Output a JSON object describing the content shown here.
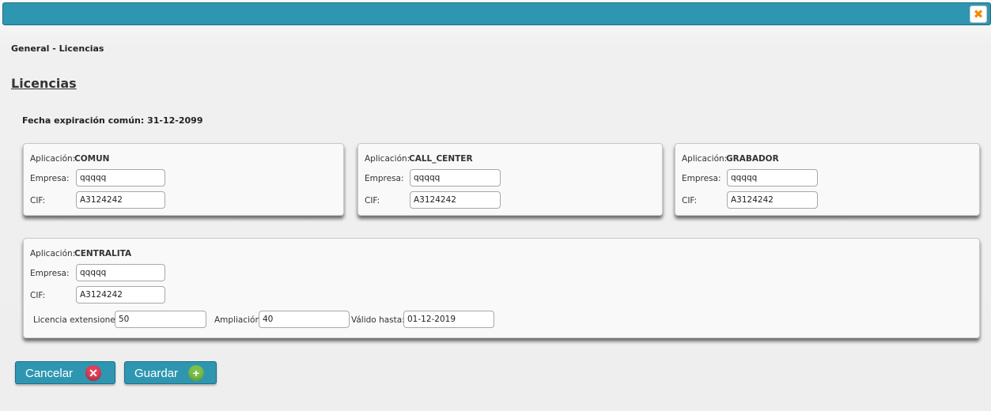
{
  "header": {
    "close_icon": "close-icon",
    "close_glyph": "✖"
  },
  "breadcrumb": "General - Licencias",
  "page_title": "Licencias",
  "common_expiration": "Fecha expiración común: 31-12-2099",
  "labels": {
    "aplicacion": "Aplicación:",
    "empresa": "Empresa:",
    "cif": "CIF:",
    "licencia_ext": "Licencia extensiones",
    "ampliacion": "Ampliación:",
    "valido_hasta": "Válido hasta:"
  },
  "panels": [
    {
      "app": "COMUN",
      "empresa": "qqqqq",
      "cif": "A3124242"
    },
    {
      "app": "CALL_CENTER",
      "empresa": "qqqqq",
      "cif": "A3124242"
    },
    {
      "app": "GRABADOR",
      "empresa": "qqqqq",
      "cif": "A3124242"
    },
    {
      "app": "CENTRALITA",
      "empresa": "qqqqq",
      "cif": "A3124242",
      "licencia_extensiones": "50",
      "ampliacion": "40",
      "valido_hasta": "01-12-2019"
    }
  ],
  "buttons": {
    "cancel_label": "Cancelar",
    "cancel_icon": "cancel-icon",
    "cancel_glyph": "✕",
    "save_label": "Guardar",
    "save_icon": "add-icon",
    "save_glyph": "+"
  },
  "colors": {
    "accent": "#2e96b0",
    "close": "#f08a00",
    "cancel_icon": "#e2405a",
    "save_icon": "#7cc04a"
  }
}
